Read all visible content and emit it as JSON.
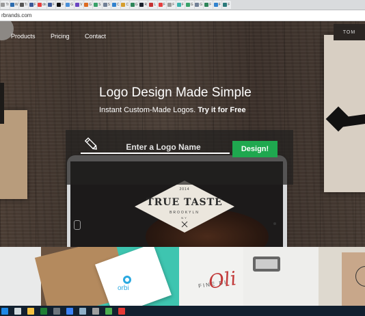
{
  "browser": {
    "url": "rbrands.com",
    "tabs": [
      {
        "label": "Tr",
        "color": "#999999"
      },
      {
        "label": "W",
        "color": "#2b6cb0"
      },
      {
        "label": "Ti",
        "color": "#555555"
      },
      {
        "label": "F",
        "color": "#3b5998"
      },
      {
        "label": "dn",
        "color": "#e53e3e"
      },
      {
        "label": "F",
        "color": "#3b5998"
      },
      {
        "label": "F",
        "color": "#111111"
      },
      {
        "label": "G",
        "color": "#4a90d9"
      },
      {
        "label": "V",
        "color": "#6b46c1"
      },
      {
        "label": "G",
        "color": "#dd6b20"
      },
      {
        "label": "S",
        "color": "#38a169"
      },
      {
        "label": "S",
        "color": "#718096"
      },
      {
        "label": "C",
        "color": "#3182ce"
      },
      {
        "label": "C",
        "color": "#d69e2e"
      },
      {
        "label": "G",
        "color": "#2f855a"
      },
      {
        "label": "R",
        "color": "#1a202c"
      },
      {
        "label": "L",
        "color": "#c53030"
      },
      {
        "label": "F",
        "color": "#e53e3e"
      },
      {
        "label": "F",
        "color": "#999999"
      },
      {
        "label": "F",
        "color": "#38b2ac"
      },
      {
        "label": "G",
        "color": "#38a169"
      },
      {
        "label": "G",
        "color": "#718096"
      },
      {
        "label": "F",
        "color": "#2f855a"
      },
      {
        "label": "F",
        "color": "#3182ce"
      },
      {
        "label": "F",
        "color": "#2c7a7b"
      }
    ]
  },
  "nav": {
    "links": [
      "Products",
      "Pricing",
      "Contact"
    ],
    "login_label": "TOM"
  },
  "hero": {
    "title": "Logo Design Made Simple",
    "subtitle": "Instant Custom-Made Logos.",
    "subtitle_cta": "Try it for Free",
    "input_placeholder": "Enter a Logo Name",
    "design_button": "Design!"
  },
  "sample_logo": {
    "year": "2014",
    "name": "TRUE TASTE",
    "city": "BROOKYLN",
    "state": "NY"
  },
  "gallery": {
    "orbi_text": "orbi",
    "script_text": "Oli",
    "fine_text": "FINE DI"
  },
  "colors": {
    "accent_green": "#1fa84f",
    "taskbar": "#12202f"
  },
  "taskbar": {
    "icons": [
      {
        "name": "start-icon",
        "color": "#1e88e5"
      },
      {
        "name": "task-view-icon",
        "color": "#cfd8dc"
      },
      {
        "name": "file-explorer-icon",
        "color": "#f6c343"
      },
      {
        "name": "excel-icon",
        "color": "#1e7e34"
      },
      {
        "name": "image-viewer-icon",
        "color": "#6c757d"
      },
      {
        "name": "app-icon",
        "color": "#3b82f6"
      },
      {
        "name": "globe-icon",
        "color": "#8fb0c8"
      },
      {
        "name": "settings-icon",
        "color": "#9e9e9e"
      },
      {
        "name": "android-icon",
        "color": "#4caf50"
      },
      {
        "name": "chrome-icon",
        "color": "#e53935"
      }
    ]
  }
}
